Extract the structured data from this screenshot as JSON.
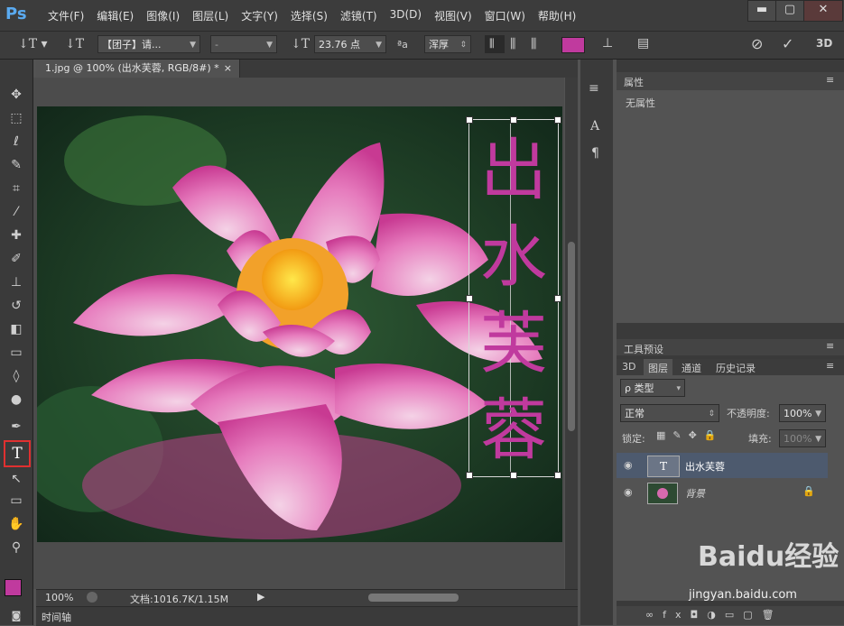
{
  "app": {
    "logo": "Ps"
  },
  "menu": [
    "文件(F)",
    "编辑(E)",
    "图像(I)",
    "图层(L)",
    "文字(Y)",
    "选择(S)",
    "滤镜(T)",
    "3D(D)",
    "视图(V)",
    "窗口(W)",
    "帮助(H)"
  ],
  "options": {
    "font_family": "【团子】请...",
    "font_style": "-",
    "font_size": "23.76 点",
    "antialias": "浑厚",
    "text_color": "#c03a9e"
  },
  "document_tab": "1.jpg @ 100% (出水芙蓉, RGB/8#) *",
  "canvas_text": [
    "出",
    "水",
    "芙",
    "蓉"
  ],
  "status": {
    "zoom": "100%",
    "doc_info": "文档:1016.7K/1.15M"
  },
  "timeline_label": "时间轴",
  "properties_panel": {
    "title": "属性",
    "body": "无属性"
  },
  "presets_panel": {
    "title": "工具预设"
  },
  "layers_panel": {
    "tabs": [
      "3D",
      "图层",
      "通道",
      "历史记录"
    ],
    "filter_label": "ρ 类型",
    "blend_mode": "正常",
    "opacity_label": "不透明度:",
    "opacity_value": "100%",
    "lock_label": "锁定:",
    "fill_label": "填充:",
    "fill_value": "100%",
    "layers": [
      {
        "name": "出水芙蓉",
        "thumb": "T"
      },
      {
        "name": "背景"
      }
    ]
  },
  "watermark": {
    "brand": "Baidu经验",
    "url": "jingyan.baidu.com"
  }
}
